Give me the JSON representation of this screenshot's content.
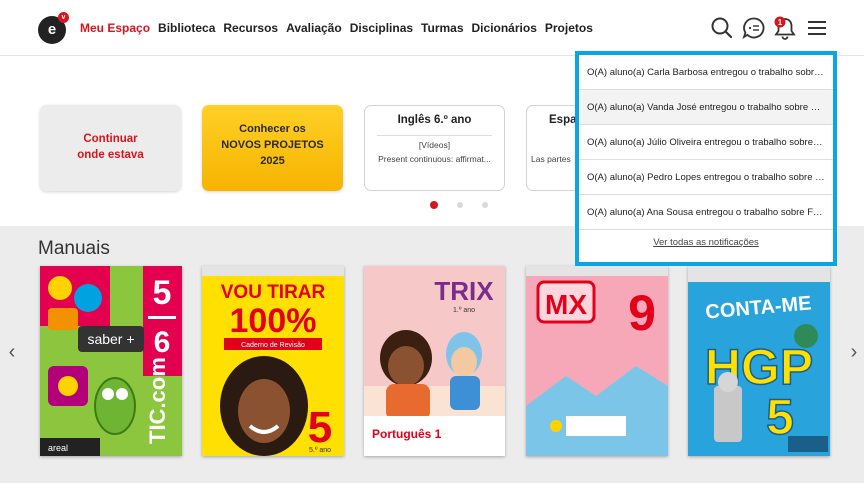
{
  "header": {
    "logo_text": "e",
    "logo_badge": "v",
    "nav": [
      "Meu Espaço",
      "Biblioteca",
      "Recursos",
      "Avaliação",
      "Disciplinas",
      "Turmas",
      "Dicionários",
      "Projetos"
    ],
    "active_nav": "Meu Espaço",
    "icons": [
      "search-icon",
      "chat-icon",
      "bell-icon",
      "menu-icon"
    ],
    "bell_badge": "1",
    "accent_color": "#d8151d"
  },
  "carousel": {
    "continue_card": {
      "line1": "Continuar",
      "line2": "onde estava"
    },
    "projects_card": {
      "line1": "Conhecer os",
      "line2": "NOVOS PROJETOS",
      "line3": "2025"
    },
    "ingles_card": {
      "title": "Inglês 6.º ano",
      "type": "[Vídeos]",
      "desc": "Present continuous: affirmat..."
    },
    "esp_card": {
      "title": "Espa",
      "desc": "Las partes"
    },
    "active_dot": 1
  },
  "manuais": {
    "title": "Manuais",
    "books": [
      {
        "top": "5",
        "bottom": "6",
        "brand": "saber +",
        "title": "TIC.com",
        "publisher": "areal"
      },
      {
        "title_line1": "VOU TIRAR",
        "title_line2": "100%",
        "subtitle": "Caderno de Revisão",
        "grade": "5",
        "grade_label": "5.º ano"
      },
      {
        "title": "TRIX",
        "subtitle": "1.º ano",
        "label": "Português 1"
      },
      {
        "title": "MX",
        "grade": "9"
      },
      {
        "title": "CONTA-ME",
        "subject": "HGP",
        "grade": "5"
      }
    ]
  },
  "notifications": {
    "items": [
      "O(A) aluno(a) Carla Barbosa entregou o trabalho sobre Frações",
      "O(A) aluno(a) Vanda José entregou o trabalho sobre Frações",
      "O(A) aluno(a) Júlio Oliveira entregou o trabalho sobre Frações",
      "O(A) aluno(a) Pedro Lopes entregou o trabalho sobre Frações",
      "O(A) aluno(a) Ana Sousa entregou o trabalho sobre Frações"
    ],
    "see_all": "Ver todas as notificações",
    "highlight_color": "#0aa6e3"
  }
}
